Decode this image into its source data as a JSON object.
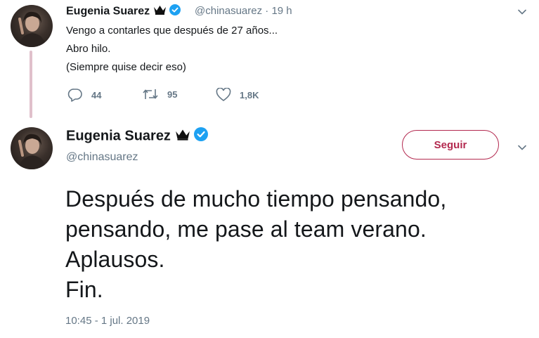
{
  "reply_tweet": {
    "author_name": "Eugenia Suarez",
    "author_handle": "@chinasuarez",
    "time_ago": "19 h",
    "lines": [
      "Vengo a contarles que después de 27 años...",
      "Abro hilo.",
      "(Siempre quise decir eso)"
    ],
    "stats": {
      "replies": "44",
      "retweets": "95",
      "likes": "1,8K"
    }
  },
  "main_tweet": {
    "author_name": "Eugenia Suarez",
    "author_handle": "@chinasuarez",
    "follow_label": "Seguir",
    "lines": [
      "Después de mucho tiempo pensando,",
      "pensando, me pase al team verano.",
      "Aplausos.",
      "Fin."
    ],
    "timestamp": "10:45 - 1 jul. 2019"
  },
  "colors": {
    "accent": "#b3294f",
    "verified": "#1da1f2",
    "muted": "#657786",
    "thread_line": "#e0c0cb"
  },
  "icons": {
    "reply": "reply-icon",
    "retweet": "retweet-icon",
    "like": "heart-icon",
    "more": "chevron-down-icon",
    "verified": "verified-badge-icon",
    "crown": "crown-emoji-icon"
  }
}
